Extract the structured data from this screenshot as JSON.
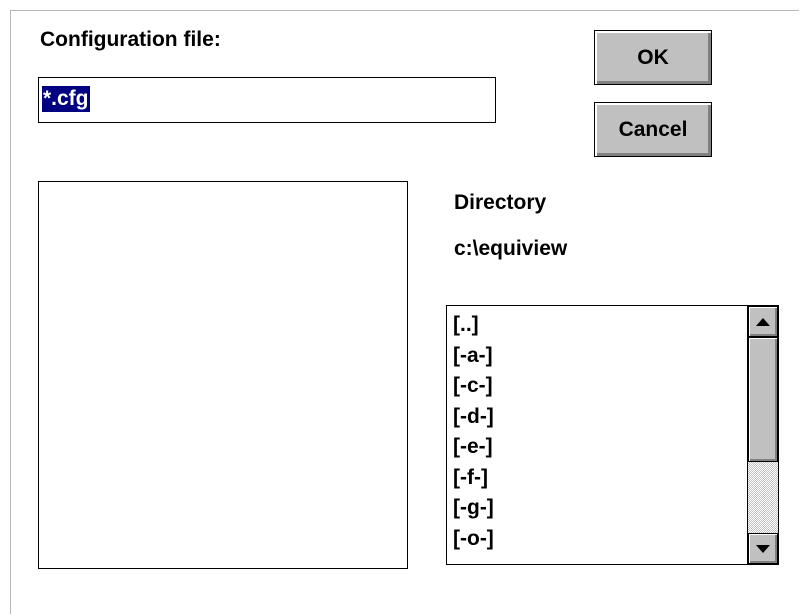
{
  "dialog": {
    "filename_label": "Configuration file:",
    "filename_value": "*.cfg",
    "ok_label": "OK",
    "cancel_label": "Cancel",
    "directory_label": "Directory",
    "current_directory": "c:\\equiview",
    "directory_items": [
      "[..]",
      "[-a-]",
      "[-c-]",
      "[-d-]",
      "[-e-]",
      "[-f-]",
      "[-g-]",
      "[-o-]"
    ],
    "file_items": []
  },
  "icons": {
    "scroll_up": "arrow-up-icon",
    "scroll_down": "arrow-down-icon"
  },
  "colors": {
    "selection_bg": "#000080",
    "selection_fg": "#ffffff",
    "button_face": "#c0c0c0"
  },
  "scrollbar": {
    "position": 0,
    "visible_fraction": 0.55
  }
}
